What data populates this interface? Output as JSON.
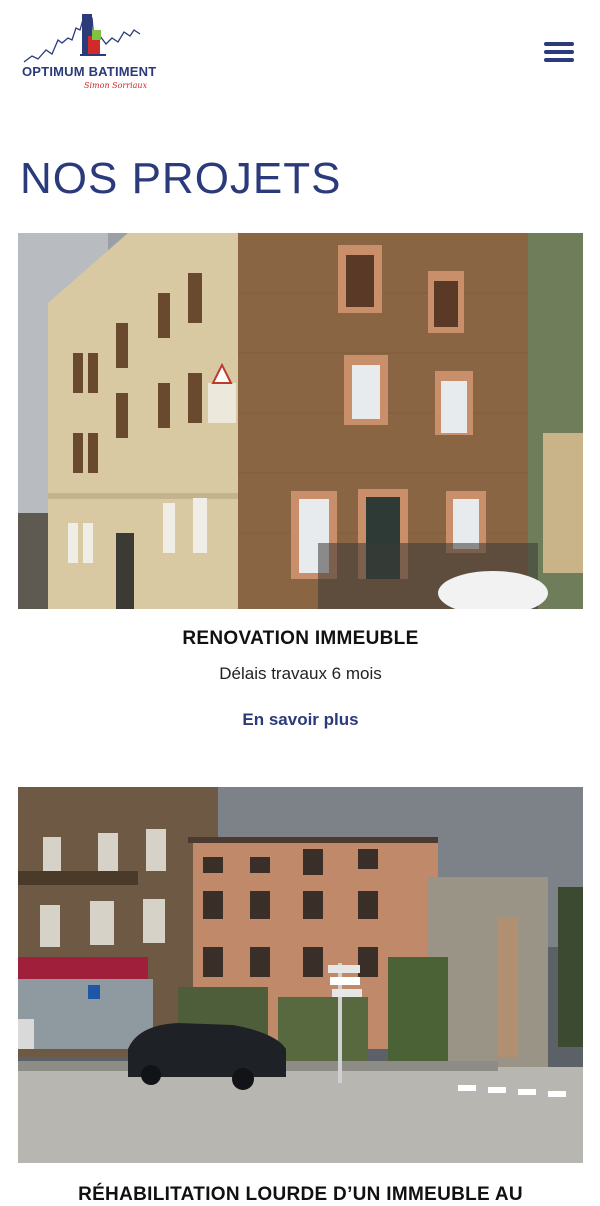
{
  "header": {
    "logo_name": "OPTIMUM BATIMENT",
    "logo_tagline": "Simon Sorriaux",
    "menu_icon": "hamburger-menu-icon"
  },
  "main": {
    "title": "NOS PROJETS",
    "projects": [
      {
        "title": "RENOVATION IMMEUBLE",
        "subtitle": "Délais travaux 6 mois",
        "link_label": "En savoir plus",
        "image": "building-photo-stone-facade"
      },
      {
        "title": "RÉHABILITATION LOURDE D’UN IMMEUBLE AU",
        "image": "building-photo-street-corner"
      }
    ]
  },
  "colors": {
    "brand_blue": "#2b3a7a",
    "brand_red": "#d12a2a"
  }
}
